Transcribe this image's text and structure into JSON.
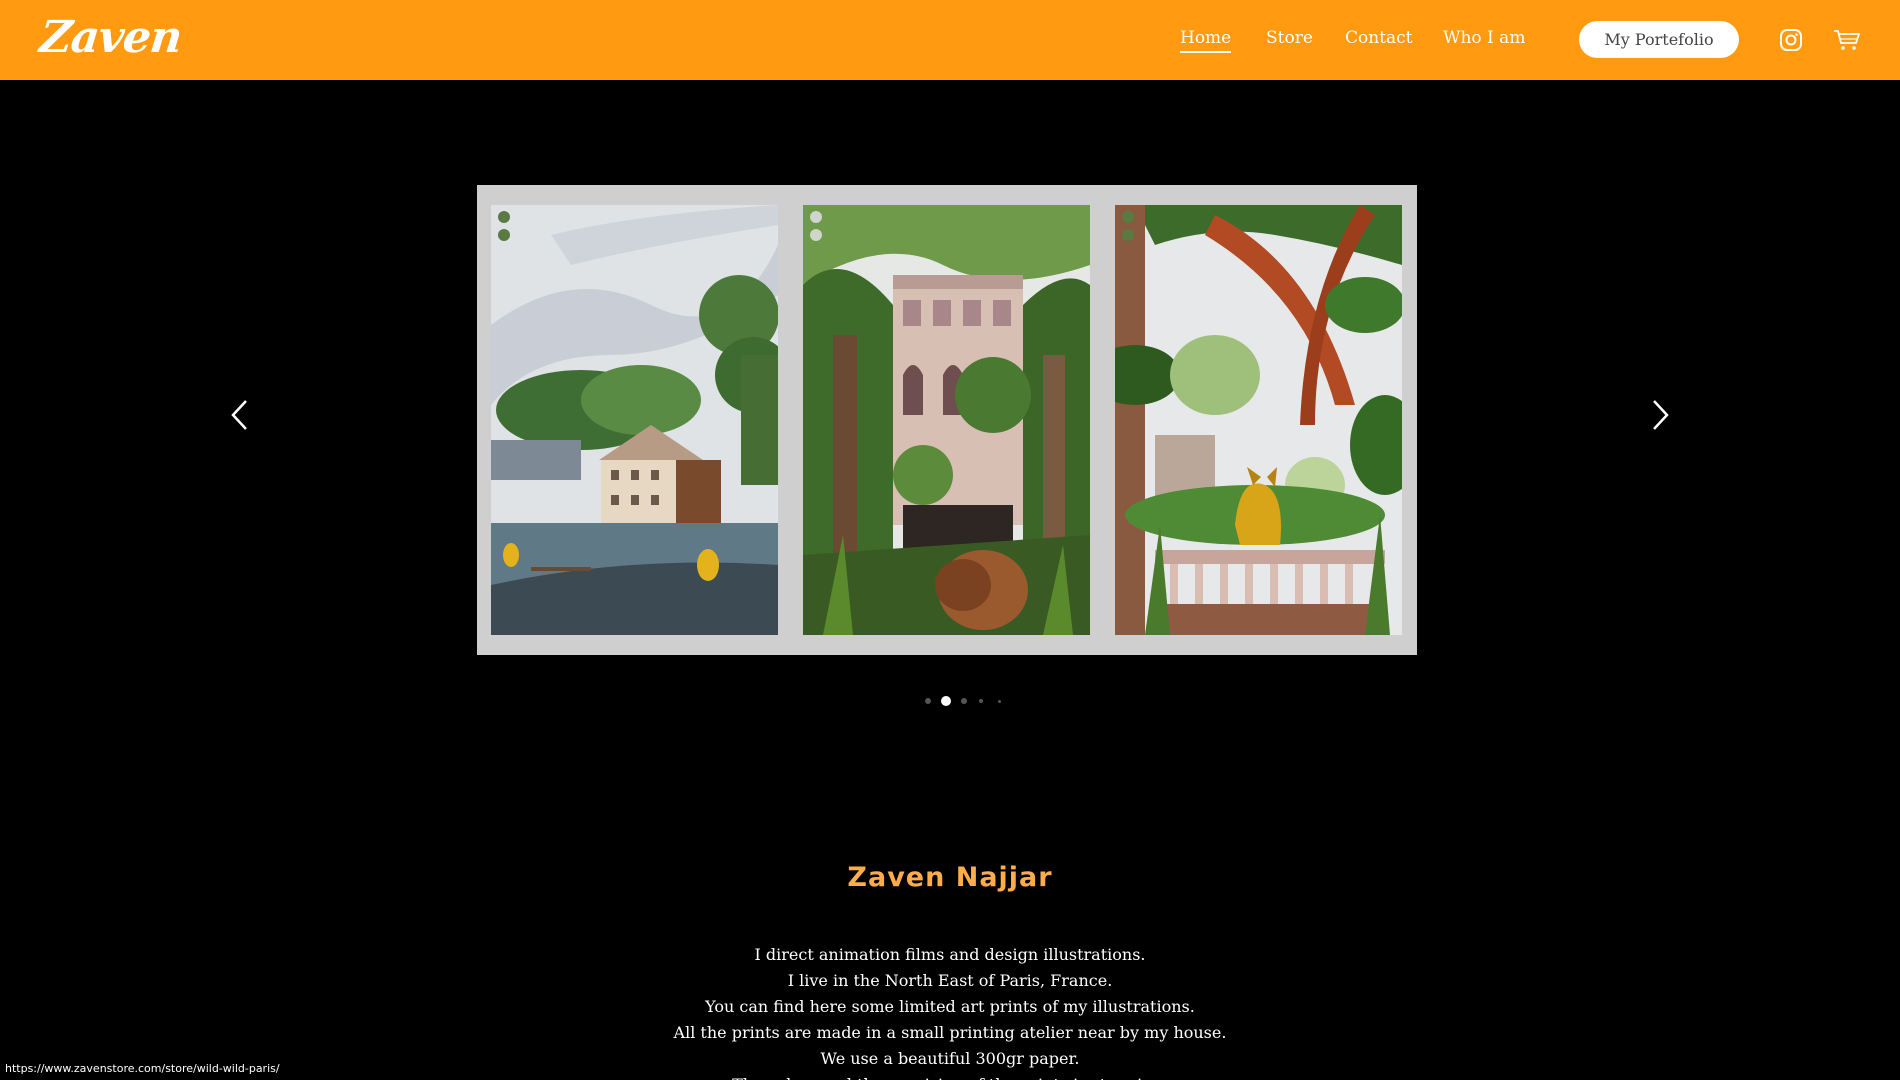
{
  "brand": {
    "logo_text": "Zaven"
  },
  "nav": {
    "items": [
      {
        "label": "Home",
        "active": true
      },
      {
        "label": "Store",
        "active": false
      },
      {
        "label": "Contact",
        "active": false
      },
      {
        "label": "Who I am",
        "active": false
      }
    ],
    "portfolio_button": "My Portefolio",
    "icons": [
      "instagram-icon",
      "cart-icon"
    ]
  },
  "slider": {
    "current_slide": 2,
    "total_slides": 5,
    "prev_icon": "chevron-left-icon",
    "next_icon": "chevron-right-icon",
    "posters": [
      {
        "subject": "house-by-lake-with-trees"
      },
      {
        "subject": "mansion-with-lion"
      },
      {
        "subject": "balcony-with-lynx"
      }
    ]
  },
  "about": {
    "title": "Zaven Najjar",
    "lines": [
      "I direct animation films and design illustrations.",
      "I live in the North East of Paris, France.",
      "You can find here some limited art prints of my illustrations.",
      "All the prints are made in a small printing atelier near by my house.",
      "We use a beautiful 300gr paper.",
      "The colors and the precision of the prints is stunning."
    ]
  },
  "status_bar": {
    "url": "https://www.zavenstore.com/store/wild-wild-paris/"
  },
  "colors": {
    "header": "#ff9a11",
    "title": "#ffad4a",
    "background": "#000000",
    "frame": "#cfcfcf"
  }
}
